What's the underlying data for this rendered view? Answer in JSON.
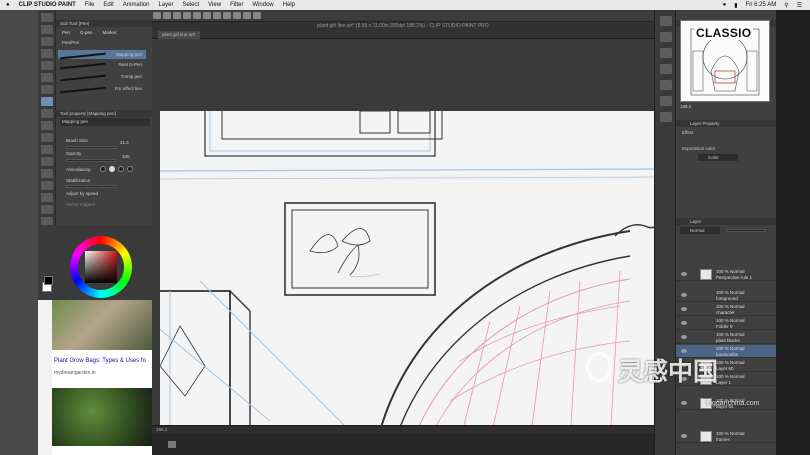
{
  "menubar": {
    "apple": "",
    "app_name": "CLIP STUDIO PAINT",
    "items": [
      "File",
      "Edit",
      "Animation",
      "Layer",
      "Select",
      "View",
      "Filter",
      "Window",
      "Help"
    ],
    "clock": "Fri 6:25 AM"
  },
  "document": {
    "tab_label": "plant girl line art*",
    "title": "plant girl line art* (8.50 x 11.00in 300dpi 188.2%) - CLIP STUDIO PAINT PRO",
    "zoom": "188.2"
  },
  "subtool": {
    "header": "Sub Tool [Pen]",
    "tabs": [
      "Pen",
      "G-pen",
      "Marker"
    ],
    "group": "Pen/Pen",
    "brushes": [
      "Mapping pen",
      "Real G-Pen",
      "Turnip pen",
      "For effect line"
    ]
  },
  "tool_property": {
    "header": "Tool property [Mapping pen]",
    "name": "Mapping pen",
    "brush_size_label": "Brush Size",
    "brush_size_value": "31.5",
    "opacity_label": "Opacity",
    "opacity_value": "100",
    "antialiasing_label": "Anti-aliasing",
    "stabilization_label": "Stabilization",
    "adjust_speed_label": "Adjust by speed",
    "vector_magnet_label": "Vector magnet"
  },
  "colors": {
    "accent": "#6d8fb8",
    "main_color": "#d01515",
    "pencil_lines": "#a7c4df",
    "red_sketch": "#e39aa9"
  },
  "browser": {
    "title": "Plant Grow Bags: Types & Uses fo",
    "url": "mydreamgarden.in"
  },
  "navigator": {
    "header": "Navigator",
    "zoom": "188.2"
  },
  "layer_property": {
    "header": "Layer Property",
    "effect_label": "Effect",
    "expression_label": "Expression color",
    "expression_value": "Color"
  },
  "layers": {
    "header": "Layer",
    "blend_mode": "Normal",
    "items": [
      {
        "l1": "100 % Normal",
        "l2": "Perspective rule 1"
      },
      {
        "l1": "100 % Normal",
        "l2": "foreground"
      },
      {
        "l1": "100 % Normal",
        "l2": "character"
      },
      {
        "l1": "100 % Normal",
        "l2": "Folder 9"
      },
      {
        "l1": "100 % Normal",
        "l2": "plant blocks"
      },
      {
        "l1": "100 % Normal",
        "l2": "boomonibs"
      },
      {
        "l1": "100 % Normal",
        "l2": "Layer 60"
      },
      {
        "l1": "100 % Normal",
        "l2": "Layer 1"
      },
      {
        "l1": "100 % Normal",
        "l2": "Layer 64"
      },
      {
        "l1": "100 % Normal",
        "l2": "frames"
      }
    ]
  },
  "overlays": {
    "brand": "CLASSIO",
    "watermark": "灵感中国",
    "watermark_url": "lingganchina.com"
  }
}
